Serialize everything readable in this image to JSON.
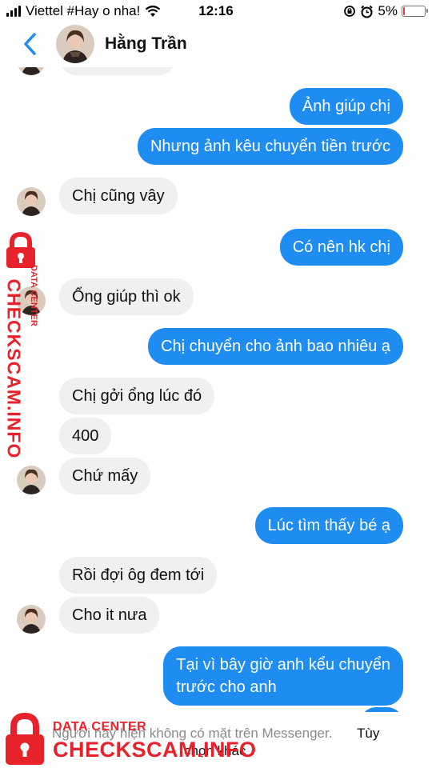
{
  "status_bar": {
    "carrier": "Viettel #Hay o nha!",
    "time": "12:16",
    "battery": "5%",
    "battery_level": 0.05,
    "battery_color": "#e23b3b"
  },
  "header": {
    "contact_name": "Hằng Trần",
    "back_icon": "chevron-left-icon"
  },
  "colors": {
    "outgoing_bubble": "#1e8cf0",
    "incoming_bubble": "#f0f0f0",
    "accent": "#1e8cf0",
    "watermark": "#e8222a"
  },
  "messages": [
    {
      "direction": "out",
      "text": "Ảnh giúp chị"
    },
    {
      "direction": "out",
      "text": "Nhưng ảnh kêu chuyển tiền trước"
    },
    {
      "direction": "in",
      "text": "Chị cũng vây"
    },
    {
      "direction": "out",
      "text": "Có nên hk chị"
    },
    {
      "direction": "in",
      "text": "Ổng giúp thì ok"
    },
    {
      "direction": "out",
      "text": "Chị chuyển cho ảnh bao nhiêu ạ"
    },
    {
      "direction": "in",
      "text": "Chị gởi ổng lúc đó"
    },
    {
      "direction": "in",
      "text": "400"
    },
    {
      "direction": "in",
      "text": "Chứ mấy"
    },
    {
      "direction": "out",
      "text": "Lúc tìm thấy bé ạ"
    },
    {
      "direction": "in",
      "text": "Rồi đợi ôg đem tới"
    },
    {
      "direction": "in",
      "text": "Cho it nưa"
    },
    {
      "direction": "out",
      "text": "Tại vì bây giờ anh kểu chuyển\ntrước cho anh"
    }
  ],
  "bottom_notice": {
    "text": "Người này hiện không có mặt trên Messenger.",
    "action": "Tùy",
    "action_cont": "chọn khác"
  },
  "watermark": {
    "label_small": "DATA CENTER",
    "label_big": "CHECKSCAM.INFO"
  }
}
